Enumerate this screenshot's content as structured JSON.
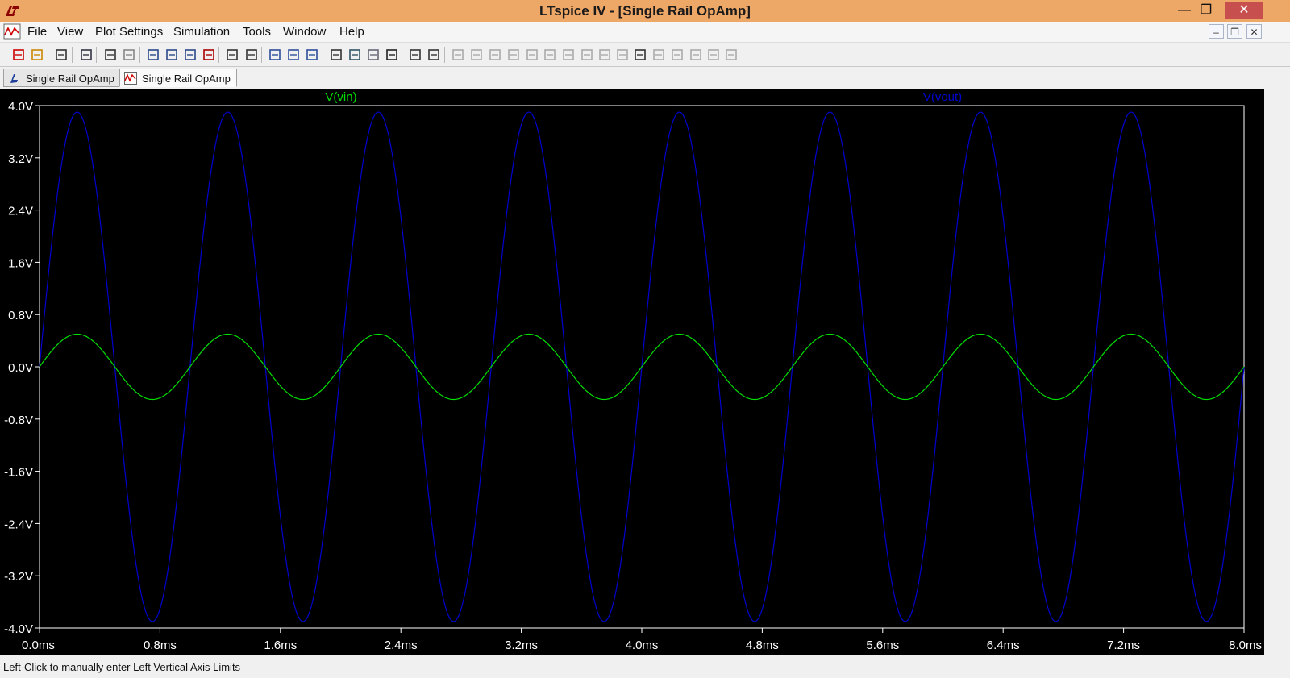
{
  "window": {
    "title": "LTspice IV - [Single Rail OpAmp]"
  },
  "window_controls": {
    "minimize": "—",
    "maximize": "❐",
    "close": "✕"
  },
  "menu": [
    "File",
    "View",
    "Plot Settings",
    "Simulation",
    "Tools",
    "Window",
    "Help"
  ],
  "mdi_controls": {
    "minimize": "–",
    "restore": "❐",
    "close": "✕"
  },
  "tabs": [
    {
      "label": "Single Rail OpAmp",
      "icon": "schematic-icon",
      "active": false
    },
    {
      "label": "Single Rail OpAmp",
      "icon": "waveform-icon",
      "active": true
    }
  ],
  "toolbar_icons": [
    "new-schematic-icon",
    "open-icon",
    "save-icon",
    "control-panel-icon",
    "run-icon",
    "halt-icon",
    "zoom-in-icon",
    "zoom-area-icon",
    "zoom-out-icon",
    "zoom-cancel-icon",
    "autorange-icon",
    "autoscale-icon",
    "tile-horizontal-icon",
    "cascade-icon",
    "tile-vertical-icon",
    "cut-icon",
    "copy-icon",
    "paste-icon",
    "find-icon",
    "print-setup-icon",
    "print-icon",
    "wire-icon",
    "ground-icon",
    "label-net-icon",
    "resistor-icon",
    "capacitor-icon",
    "inductor-icon",
    "diode-icon",
    "component-icon",
    "move-icon",
    "drag-icon",
    "undo-icon",
    "redo-icon",
    "rotate-icon",
    "mirror-icon",
    "text-icon",
    "spice-directive-icon"
  ],
  "chart_data": {
    "type": "line",
    "series": [
      {
        "name": "V(vin)",
        "color": "#00e000",
        "amplitude": 0.5,
        "frequency_hz": 1000,
        "phase_deg": 0
      },
      {
        "name": "V(vout)",
        "color": "#0000d0",
        "amplitude": 3.9,
        "frequency_hz": 1000,
        "phase_deg": 0
      }
    ],
    "xlim": [
      0,
      0.008
    ],
    "ylim": [
      -4.0,
      4.0
    ],
    "x_ticks": [
      "0.0ms",
      "0.8ms",
      "1.6ms",
      "2.4ms",
      "3.2ms",
      "4.0ms",
      "4.8ms",
      "5.6ms",
      "6.4ms",
      "7.2ms",
      "8.0ms"
    ],
    "y_ticks": [
      "4.0V",
      "3.2V",
      "2.4V",
      "1.6V",
      "0.8V",
      "0.0V",
      "-0.8V",
      "-1.6V",
      "-2.4V",
      "-3.2V",
      "-4.0V"
    ],
    "x_tick_values": [
      0,
      0.0008,
      0.0016,
      0.0024,
      0.0032,
      0.004,
      0.0048,
      0.0056,
      0.0064,
      0.0072,
      0.008
    ],
    "y_tick_values": [
      4.0,
      3.2,
      2.4,
      1.6,
      0.8,
      0.0,
      -0.8,
      -1.6,
      -2.4,
      -3.2,
      -4.0
    ],
    "background": "#000000",
    "axis_color": "#ffffff",
    "grid": false
  },
  "status": {
    "text": "Left-Click to manually enter Left Vertical Axis Limits"
  }
}
